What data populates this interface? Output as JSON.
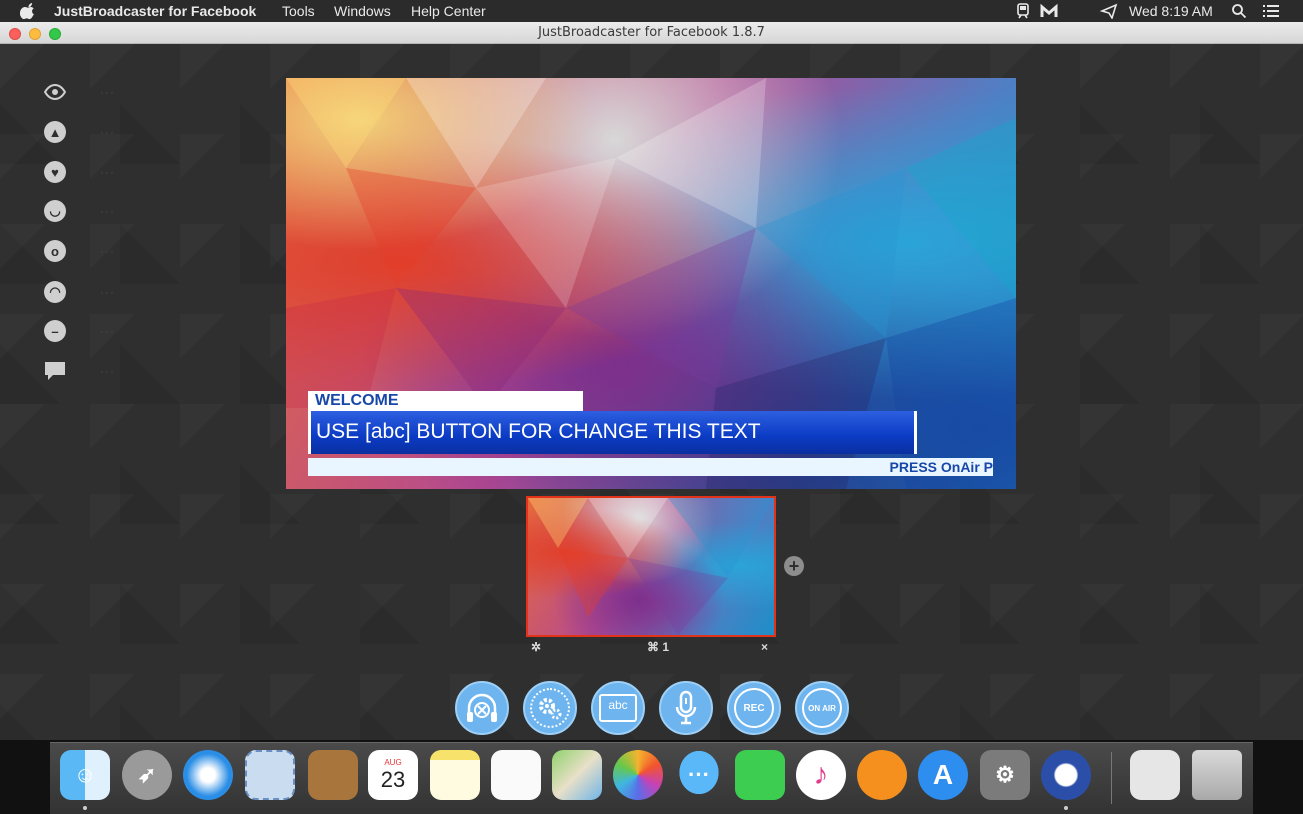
{
  "menubar": {
    "app_name": "JustBroadcaster for Facebook",
    "menus": [
      "Tools",
      "Windows",
      "Help Center"
    ],
    "clock": "Wed 8:19 AM"
  },
  "window": {
    "title": "JustBroadcaster for Facebook 1.8.7"
  },
  "reactions": [
    {
      "name": "view",
      "icon": "eye-icon",
      "count": "···"
    },
    {
      "name": "like",
      "icon": "thumbs-up-icon",
      "count": "···"
    },
    {
      "name": "love",
      "icon": "heart-icon",
      "count": "···"
    },
    {
      "name": "haha",
      "icon": "laugh-icon",
      "count": "···"
    },
    {
      "name": "wow",
      "icon": "wow-icon",
      "count": "···"
    },
    {
      "name": "sad",
      "icon": "sad-icon",
      "count": "···"
    },
    {
      "name": "angry",
      "icon": "angry-icon",
      "count": "···"
    },
    {
      "name": "comment",
      "icon": "comment-icon",
      "count": "···"
    }
  ],
  "preview": {
    "welcome": "WELCOME",
    "headline": "USE [abc] BUTTON FOR CHANGE THIS TEXT",
    "ticker": "PRESS  OnAir  P"
  },
  "scene": {
    "shortcut": "⌘ 1",
    "settings_glyph": "✲",
    "close_glyph": "×",
    "add_glyph": "+",
    "border_color": "#e2321a"
  },
  "controls": [
    {
      "name": "audio-mixer-button",
      "label": ""
    },
    {
      "name": "settings-button",
      "label": ""
    },
    {
      "name": "text-editor-button",
      "label": "abc"
    },
    {
      "name": "microphone-button",
      "label": ""
    },
    {
      "name": "record-button",
      "label": "REC"
    },
    {
      "name": "on-air-button",
      "label": "ON AIR"
    }
  ],
  "dock": {
    "day_number": "23",
    "month": "AUG",
    "apps": [
      "Finder",
      "Launchpad",
      "Safari",
      "Mail",
      "Contacts",
      "Calendar",
      "Notes",
      "Reminders",
      "Maps",
      "Photos",
      "Messages",
      "FaceTime",
      "iTunes",
      "iBooks",
      "App Store",
      "System Preferences",
      "JustBroadcaster",
      "Preview",
      "Trash"
    ]
  },
  "colors": {
    "accent_button": "#6eb4ef",
    "lower_third_blue": "#0b3bc4"
  }
}
